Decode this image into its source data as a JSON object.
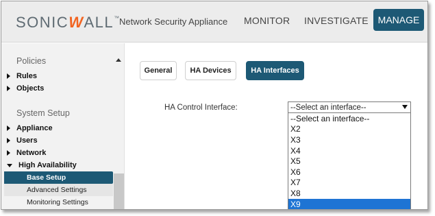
{
  "header": {
    "logo_main": "SONIC",
    "logo_w": "W",
    "logo_rest": "ALL",
    "logo_tm": "™",
    "product": "Network Security Appliance",
    "nav": [
      "MONITOR",
      "INVESTIGATE",
      "MANAGE"
    ]
  },
  "sidebar": {
    "policies_head": "Policies",
    "rules": "Rules",
    "objects": "Objects",
    "system_head": "System Setup",
    "appliance": "Appliance",
    "users": "Users",
    "network": "Network",
    "ha": "High Availability",
    "sub": [
      "Base Setup",
      "Advanced Settings",
      "Monitoring Settings"
    ]
  },
  "tabs": [
    "General",
    "HA Devices",
    "HA Interfaces"
  ],
  "form": {
    "label": "HA Control Interface:",
    "select_value": "--Select an interface--",
    "options": [
      "--Select an interface--",
      "X2",
      "X3",
      "X4",
      "X5",
      "X6",
      "X7",
      "X8",
      "X9"
    ],
    "highlighted_option": "X9"
  },
  "colors": {
    "brand_dark": "#1d5975",
    "logo_orange": "#f26522",
    "selection_blue": "#1e74d4"
  }
}
